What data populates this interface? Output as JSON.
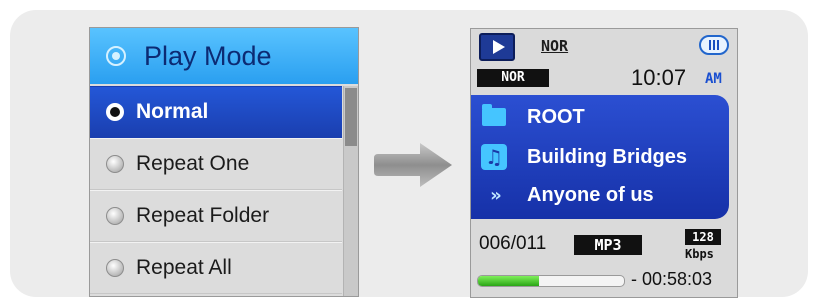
{
  "menu": {
    "title": "Play Mode",
    "items": [
      {
        "label": "Normal",
        "selected": true
      },
      {
        "label": "Repeat One",
        "selected": false
      },
      {
        "label": "Repeat Folder",
        "selected": false
      },
      {
        "label": "Repeat All",
        "selected": false
      }
    ]
  },
  "player": {
    "eq_top": "NOR",
    "eq_badge": "NOR",
    "time": "10:07",
    "ampm": "AM",
    "folder": "ROOT",
    "title": "Building Bridges",
    "next": "Anyone of us",
    "counter": "006/011",
    "format": "MP3",
    "bitrate": "128",
    "bitrate_unit": "Kbps",
    "progress_fraction": 0.42,
    "remaining": "- 00:58:03"
  },
  "icons": {
    "menu_header": "play-mode-icon",
    "play": "play-icon",
    "battery": "battery-icon",
    "folder": "folder-icon",
    "music": "music-note-icon",
    "next": "fast-forward-icon",
    "arrow": "right-arrow-icon"
  },
  "colors": {
    "menu_header": "#2a9ff0",
    "selected_item": "#1f4ac4",
    "track_box": "#1f3fc0",
    "progress_fill": "#2aa515"
  }
}
